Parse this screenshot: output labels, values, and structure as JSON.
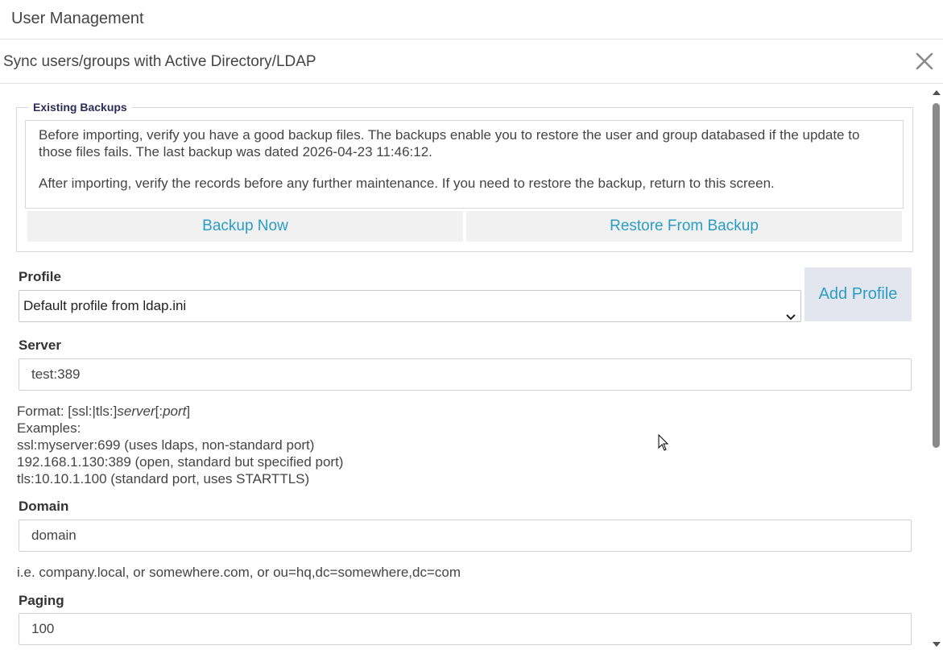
{
  "app": {
    "title": "User Management"
  },
  "dialog": {
    "title": "Sync users/groups with Active Directory/LDAP",
    "close_icon": "close-icon"
  },
  "backups": {
    "legend": "Existing Backups",
    "paragraph1": "Before importing, verify you have a good backup files. The backups enable you to restore the user and group databased if the update to those files fails. The last backup was dated 2026-04-23 11:46:12.",
    "paragraph2": "After importing, verify the records before any further maintenance. If you need to restore the backup, return to this screen.",
    "backup_now": "Backup Now",
    "restore": "Restore From Backup"
  },
  "profile": {
    "label": "Profile",
    "selected": "Default profile from ldap.ini",
    "add_button": "Add Profile"
  },
  "server": {
    "label": "Server",
    "value": "test:389",
    "help_format_prefix": "Format: [ssl:|tls:]",
    "help_format_server": "server",
    "help_format_mid": "[:",
    "help_format_port": "port",
    "help_format_suffix": "]",
    "help_examples_title": "Examples:",
    "examples": [
      "ssl:myserver:699 (uses ldaps, non-standard port)",
      "192.168.1.130:389 (open, standard but specified port)",
      "tls:10.10.1.100 (standard port, uses STARTTLS)"
    ]
  },
  "domain": {
    "label": "Domain",
    "value": "domain",
    "help": "i.e. company.local, or somewhere.com, or ou=hq,dc=somewhere,dc=com"
  },
  "paging": {
    "label": "Paging",
    "value": "100"
  },
  "colors": {
    "accent": "#2a9dc4",
    "button_bg": "#f1f1f1",
    "add_profile_bg": "#e3e6ef",
    "legend": "#2d2d5a"
  }
}
